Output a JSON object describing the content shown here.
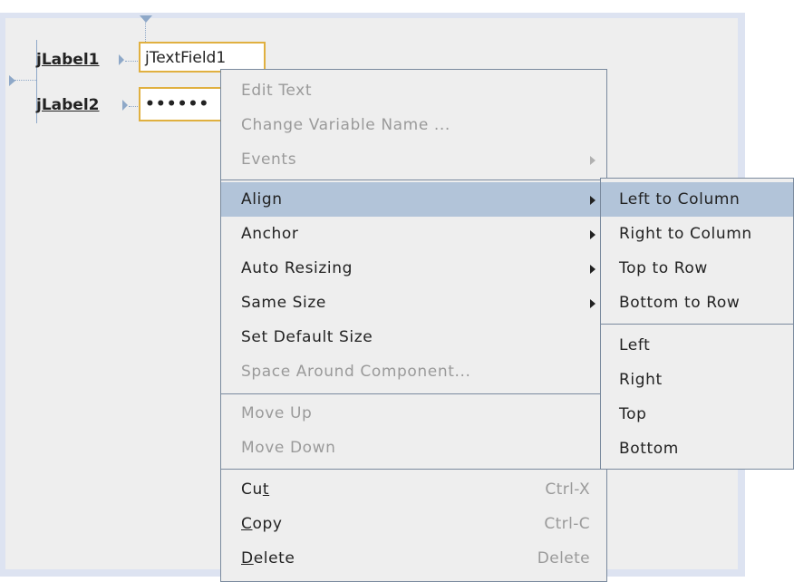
{
  "form": {
    "label1": "jLabel1",
    "label2": "jLabel2",
    "textfield": "jTextField1",
    "password": "••••••"
  },
  "context_menu": {
    "items": [
      {
        "label": "Edit Text",
        "enabled": false
      },
      {
        "label": "Change Variable Name ...",
        "enabled": false
      },
      {
        "label": "Events",
        "enabled": false,
        "submenu": true
      },
      {
        "label": "Align",
        "enabled": true,
        "submenu": true,
        "highlighted": true
      },
      {
        "label": "Anchor",
        "enabled": true,
        "submenu": true
      },
      {
        "label": "Auto Resizing",
        "enabled": true,
        "submenu": true
      },
      {
        "label": "Same Size",
        "enabled": true,
        "submenu": true
      },
      {
        "label": "Set Default Size",
        "enabled": true
      },
      {
        "label": "Space Around Component...",
        "enabled": false
      },
      {
        "label": "Move Up",
        "enabled": false
      },
      {
        "label": "Move Down",
        "enabled": false
      },
      {
        "label": "Cut",
        "mnemonic": "t",
        "shortcut": "Ctrl-X",
        "enabled": true
      },
      {
        "label": "Copy",
        "mnemonic": "C",
        "shortcut": "Ctrl-C",
        "enabled": true
      },
      {
        "label": "Delete",
        "mnemonic": "D",
        "shortcut": "Delete",
        "enabled": true
      }
    ]
  },
  "align_submenu": {
    "items": [
      {
        "label": "Left to Column",
        "highlighted": true
      },
      {
        "label": "Right to Column"
      },
      {
        "label": "Top to Row"
      },
      {
        "label": "Bottom to Row"
      },
      {
        "label": "Left"
      },
      {
        "label": "Right"
      },
      {
        "label": "Top"
      },
      {
        "label": "Bottom"
      }
    ]
  },
  "colors": {
    "menu_bg": "#eeeeee",
    "highlight": "#b2c4d9",
    "disabled_text": "#9a9a9a",
    "selection_border": "#e0b040",
    "guide": "#8ea8c8"
  }
}
